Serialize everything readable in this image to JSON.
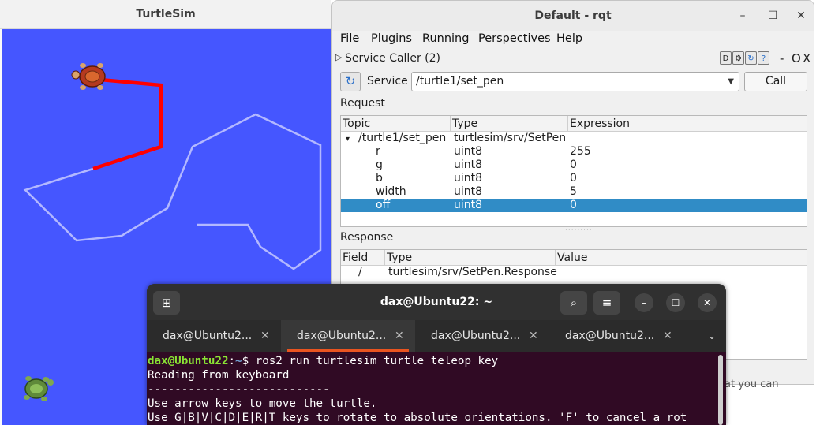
{
  "turtlesim": {
    "title": "TurtleSim"
  },
  "rqt": {
    "title": "Default - rqt",
    "window_controls": {
      "minimize": "–",
      "maximize": "☐",
      "close": "✕"
    },
    "menu": {
      "file": {
        "ul": "F",
        "rest": "ile"
      },
      "plugins": {
        "ul": "P",
        "rest": "lugins"
      },
      "running": {
        "ul": "R",
        "rest": "unning"
      },
      "perspectives": {
        "ul": "P",
        "rest": "erspectives"
      },
      "help": {
        "ul": "H",
        "rest": "elp"
      }
    },
    "plugin": {
      "title": "Service Caller (2)",
      "icons": [
        "D",
        "⚙",
        "↻",
        "?"
      ],
      "controls": {
        "min": "-",
        "float": "O",
        "close": "X"
      }
    },
    "service_label": "Service",
    "service_value": "/turtle1/set_pen",
    "call_label": "Call",
    "request_label": "Request",
    "request_columns": [
      "Topic",
      "Type",
      "Expression"
    ],
    "request_rows": [
      {
        "topic": "/turtle1/set_pen",
        "type": "turtlesim/srv/SetPen",
        "expr": ""
      },
      {
        "topic": "r",
        "type": "uint8",
        "expr": "255"
      },
      {
        "topic": "g",
        "type": "uint8",
        "expr": "0"
      },
      {
        "topic": "b",
        "type": "uint8",
        "expr": "0"
      },
      {
        "topic": "width",
        "type": "uint8",
        "expr": "5"
      },
      {
        "topic": "off",
        "type": "uint8",
        "expr": "0"
      }
    ],
    "response_label": "Response",
    "response_columns": [
      "Field",
      "Type",
      "Value"
    ],
    "response_rows": [
      {
        "field": "/",
        "type": "turtlesim/srv/SetPen.Response",
        "value": ""
      }
    ],
    "background_text": "at you can"
  },
  "terminal": {
    "title": "dax@Ubuntu22: ~",
    "tabs": [
      {
        "label": "dax@Ubuntu2...",
        "active": false
      },
      {
        "label": "dax@Ubuntu2...",
        "active": true
      },
      {
        "label": "dax@Ubuntu2...",
        "active": false
      },
      {
        "label": "dax@Ubuntu2...",
        "active": false
      }
    ],
    "prompt_user": "dax@Ubuntu22",
    "prompt_sep": ":",
    "prompt_path": "~",
    "prompt_symbol": "$ ",
    "command": "ros2 run turtlesim turtle_teleop_key",
    "lines": [
      "Reading from keyboard",
      "---------------------------",
      "Use arrow keys to move the turtle.",
      "Use G|B|V|C|D|E|R|T keys to rotate to absolute orientations. 'F' to cancel a rot"
    ]
  },
  "colors": {
    "canvas": "#4556ff",
    "trail_light": "#b3b8ff",
    "trail_red": "#ff0000",
    "selection": "#308cc6",
    "terminal_bg": "#300a24",
    "accent": "#e95420"
  }
}
